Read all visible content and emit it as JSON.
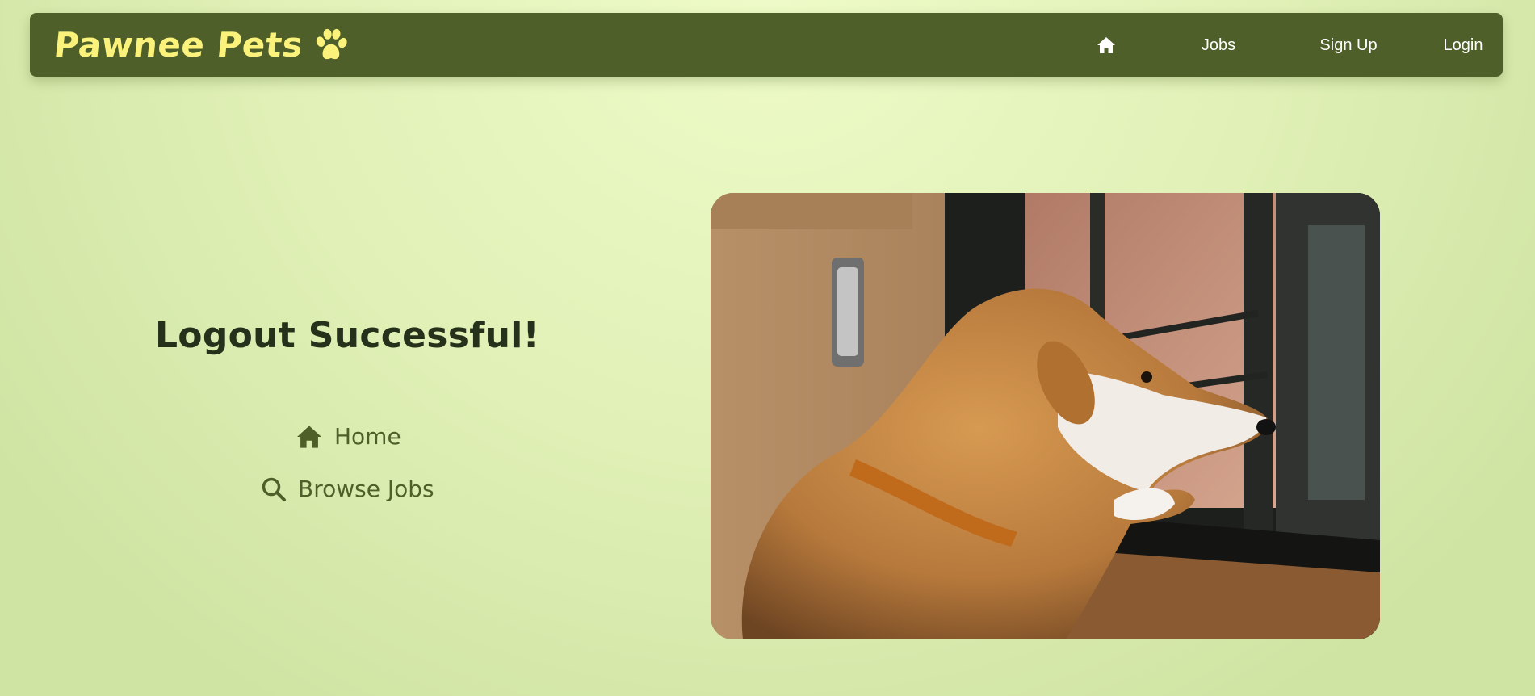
{
  "navbar": {
    "brand": "Pawnee Pets",
    "brand_icon": "paw-icon",
    "links": {
      "home_icon": "home-icon",
      "jobs": "Jobs",
      "signup": "Sign Up",
      "login": "Login"
    }
  },
  "main": {
    "title": "Logout Successful!",
    "actions": [
      {
        "icon": "home-icon",
        "label": "Home"
      },
      {
        "icon": "search-icon",
        "label": "Browse Jobs"
      }
    ]
  },
  "image": {
    "subject": "dog-looking-out-window-photo"
  },
  "colors": {
    "nav_bg": "#4f5f29",
    "brand": "#fbf27c",
    "title": "#25311a",
    "accent": "#4f5f29",
    "page_bg": "#e0f0b6"
  }
}
